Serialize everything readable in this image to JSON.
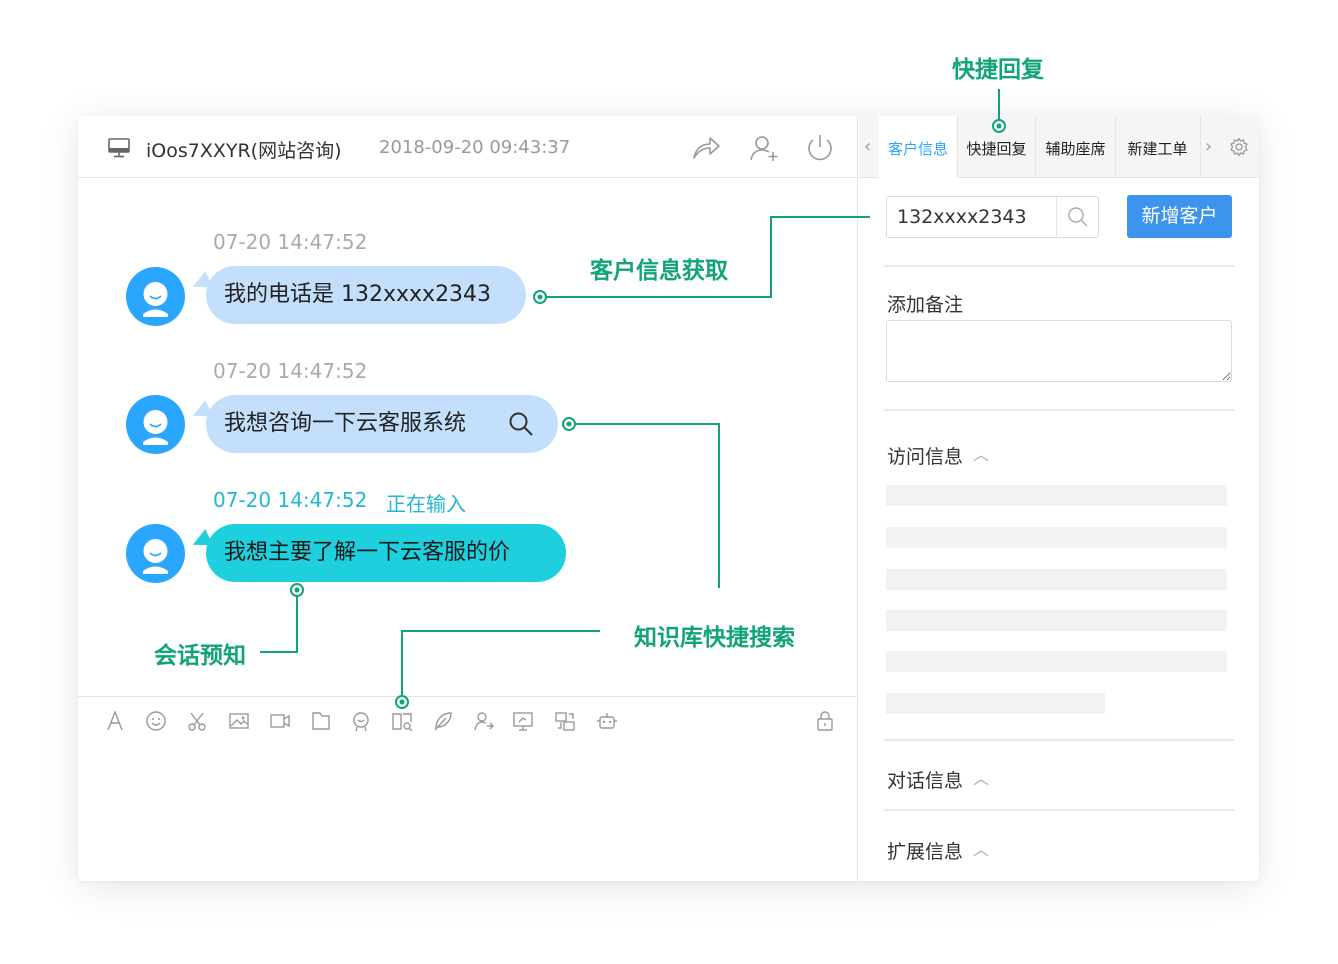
{
  "header": {
    "session_title": "iOos7XXYR(网站咨询)",
    "session_time": "2018-09-20 09:43:37",
    "icons": [
      "monitor-icon",
      "transfer-icon",
      "invite-user-icon",
      "power-icon"
    ]
  },
  "chat": {
    "messages": [
      {
        "time": "07-20 14:47:52",
        "text": "我的电话是 132xxxx2343",
        "status": ""
      },
      {
        "time": "07-20 14:47:52",
        "text": "我想咨询一下云客服系统",
        "status": ""
      },
      {
        "time": "07-20 14:47:52",
        "text": "我想主要了解一下云客服的价",
        "status": "正在输入"
      }
    ],
    "toolbar_icons": [
      "font-icon",
      "emoji-icon",
      "screenshot-icon",
      "image-icon",
      "video-icon",
      "file-icon",
      "satisfaction-icon",
      "knowledge-base-icon",
      "leave-message-icon",
      "transfer-agent-icon",
      "screen-share-icon",
      "remote-assist-icon",
      "robot-icon",
      "lock-icon"
    ]
  },
  "sidebar": {
    "tabs": [
      {
        "label": "客户信息",
        "active": true
      },
      {
        "label": "快捷回复",
        "active": false
      },
      {
        "label": "辅助座席",
        "active": false
      },
      {
        "label": "新建工单",
        "active": false
      }
    ],
    "search_value": "132xxxx2343",
    "add_customer_label": "新增客户",
    "note_label": "添加备注",
    "sections": [
      "访问信息",
      "对话信息",
      "扩展信息"
    ]
  },
  "annotations": {
    "quick_reply": "快捷回复",
    "customer_info": "客户信息获取",
    "knowledge_search": "知识库快捷搜索",
    "session_preview": "会话预知"
  },
  "colors": {
    "accent_blue": "#2aa6ff",
    "button_blue": "#3c94ee",
    "annotation_green": "#11a37a",
    "bubble_light": "#c4dffb",
    "bubble_cyan": "#1ecfde"
  }
}
